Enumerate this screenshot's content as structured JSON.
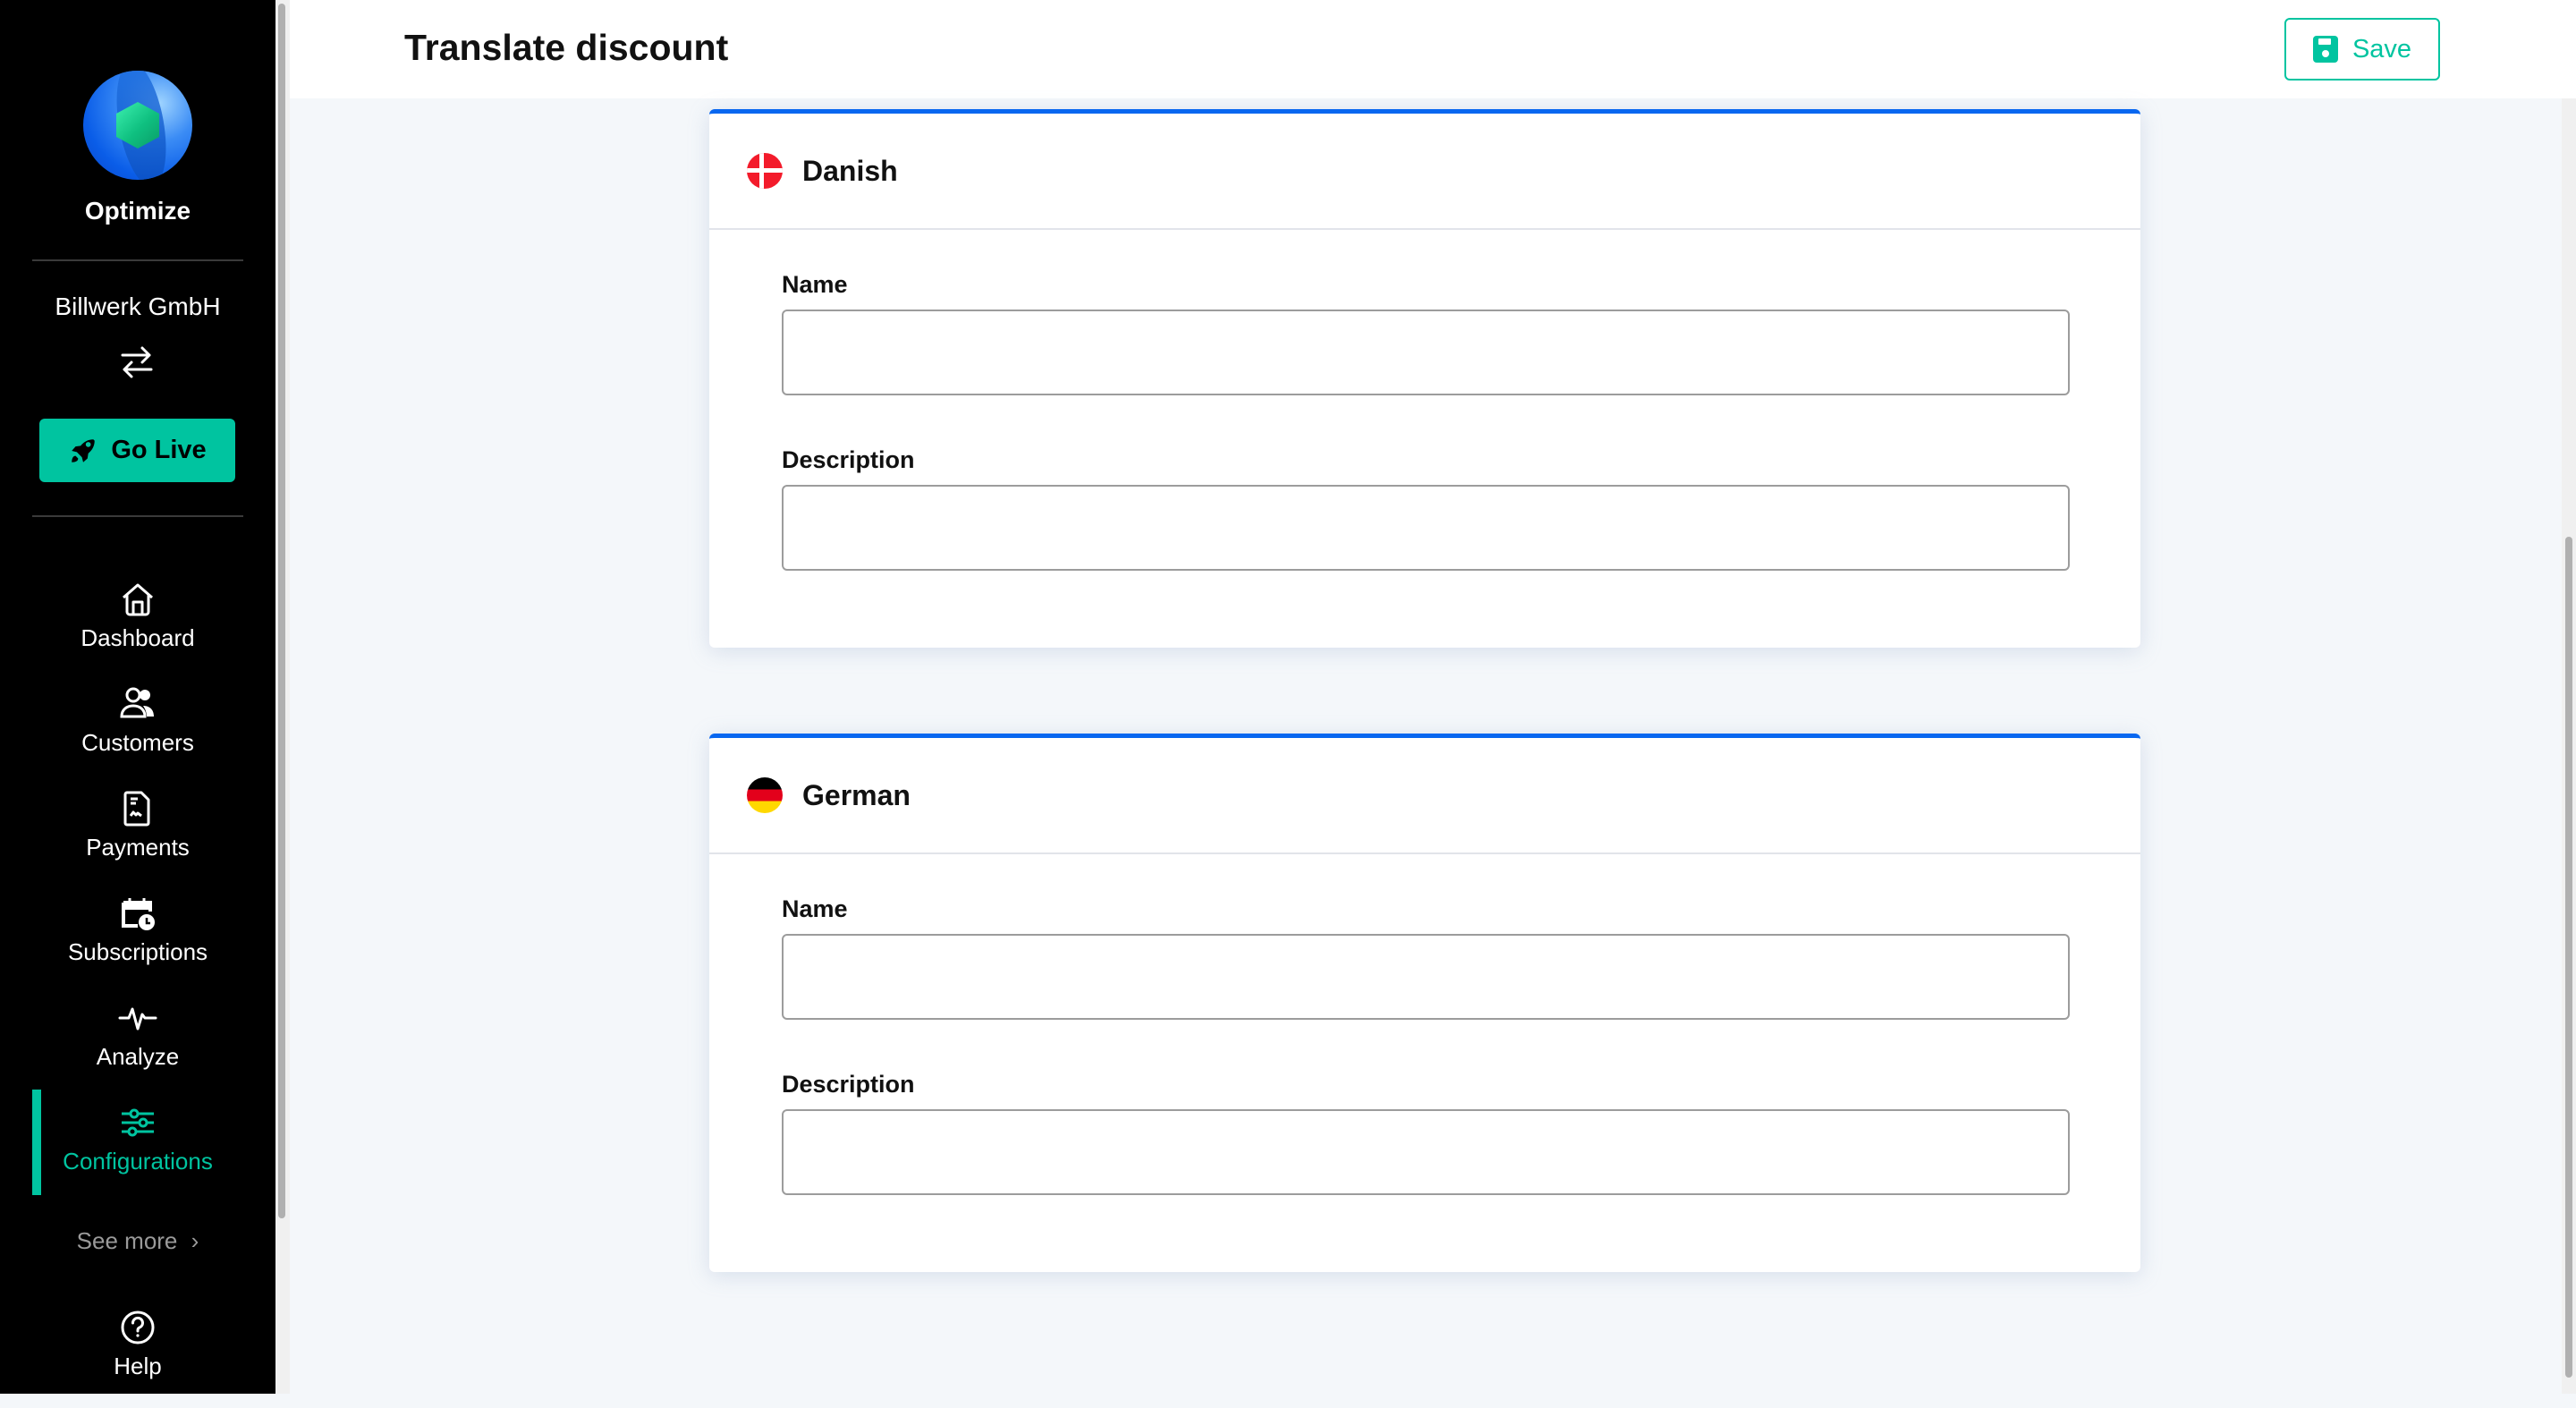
{
  "sidebar": {
    "brand": "Optimize",
    "company": "Billwerk GmbH",
    "go_live_label": "Go Live",
    "nav": [
      {
        "label": "Dashboard",
        "icon": "home-icon"
      },
      {
        "label": "Customers",
        "icon": "users-icon"
      },
      {
        "label": "Payments",
        "icon": "document-icon"
      },
      {
        "label": "Subscriptions",
        "icon": "calendar-clock-icon"
      },
      {
        "label": "Analyze",
        "icon": "pulse-icon"
      },
      {
        "label": "Configurations",
        "icon": "sliders-icon",
        "active": true
      }
    ],
    "see_more_label": "See more",
    "help_label": "Help"
  },
  "header": {
    "title": "Translate discount",
    "save_label": "Save"
  },
  "colors": {
    "accent": "#00c4a0",
    "card_top_border": "#0867f0",
    "sidebar_bg": "#000000"
  },
  "languages": [
    {
      "name": "Danish",
      "flag": "denmark-flag-icon",
      "fields": [
        {
          "label": "Name",
          "value": "",
          "placeholder": ""
        },
        {
          "label": "Description",
          "value": "",
          "placeholder": ""
        }
      ]
    },
    {
      "name": "German",
      "flag": "germany-flag-icon",
      "fields": [
        {
          "label": "Name",
          "value": "",
          "placeholder": ""
        },
        {
          "label": "Description",
          "value": "",
          "placeholder": ""
        }
      ]
    }
  ]
}
